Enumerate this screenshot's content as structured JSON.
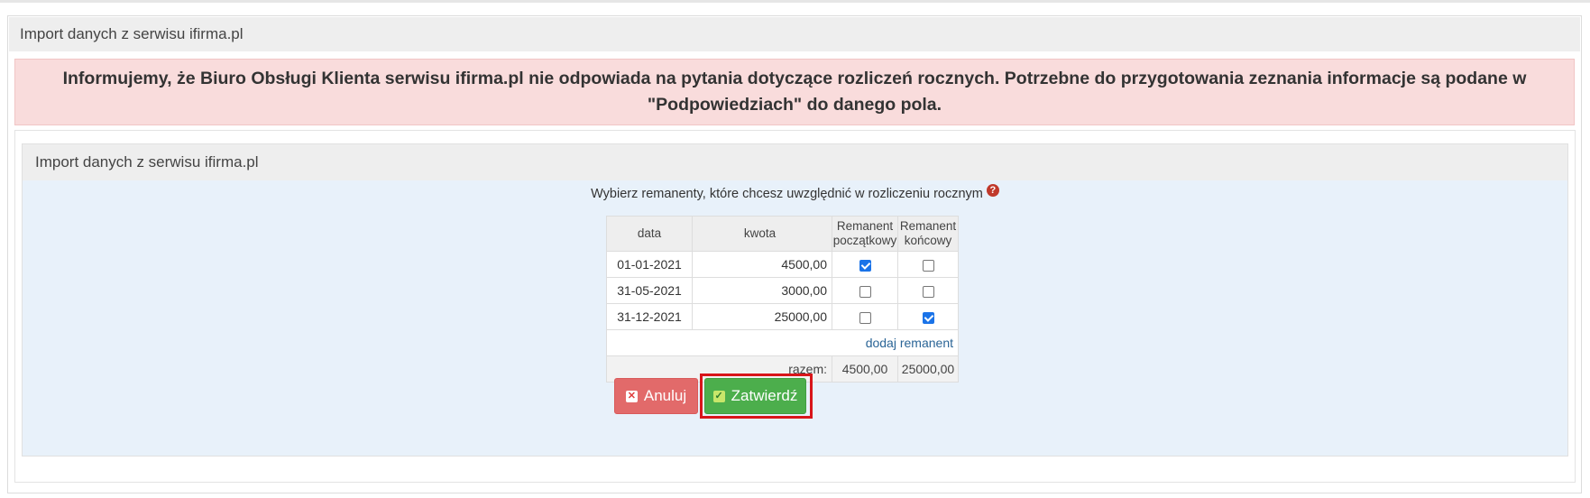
{
  "outer": {
    "title": "Import danych z serwisu ifirma.pl"
  },
  "alert": {
    "text": "Informujemy, że Biuro Obsługi Klienta serwisu ifirma.pl nie odpowiada na pytania dotyczące rozliczeń rocznych. Potrzebne do przygotowania zeznania informacje są podane w \"Podpowiedziach\" do danego pola."
  },
  "panel": {
    "title": "Import danych z serwisu ifirma.pl",
    "instruction": "Wybierz remanenty, które chcesz uwzględnić w rozliczeniu rocznym",
    "help_icon": "question-icon"
  },
  "table": {
    "headers": {
      "date": "data",
      "amount": "kwota",
      "start_line1": "Remanent",
      "start_line2": "początkowy",
      "end_line1": "Remanent",
      "end_line2": "końcowy"
    },
    "rows": [
      {
        "date": "01-01-2021",
        "amount": "4500,00",
        "start": true,
        "end": false
      },
      {
        "date": "31-05-2021",
        "amount": "3000,00",
        "start": false,
        "end": false
      },
      {
        "date": "31-12-2021",
        "amount": "25000,00",
        "start": false,
        "end": true
      }
    ],
    "add_link": "dodaj remanent",
    "sum_label": "razem:",
    "sum_start": "4500,00",
    "sum_end": "25000,00"
  },
  "buttons": {
    "cancel": "Anuluj",
    "cancel_icon": "close-icon",
    "confirm": "Zatwierdź",
    "confirm_icon": "check-icon"
  },
  "colors": {
    "alert_bg": "#f9dcdc",
    "panel_bg": "#e8f1fa",
    "cancel": "#e26a6a",
    "confirm": "#4cae4c",
    "focus": "#d8151a"
  }
}
